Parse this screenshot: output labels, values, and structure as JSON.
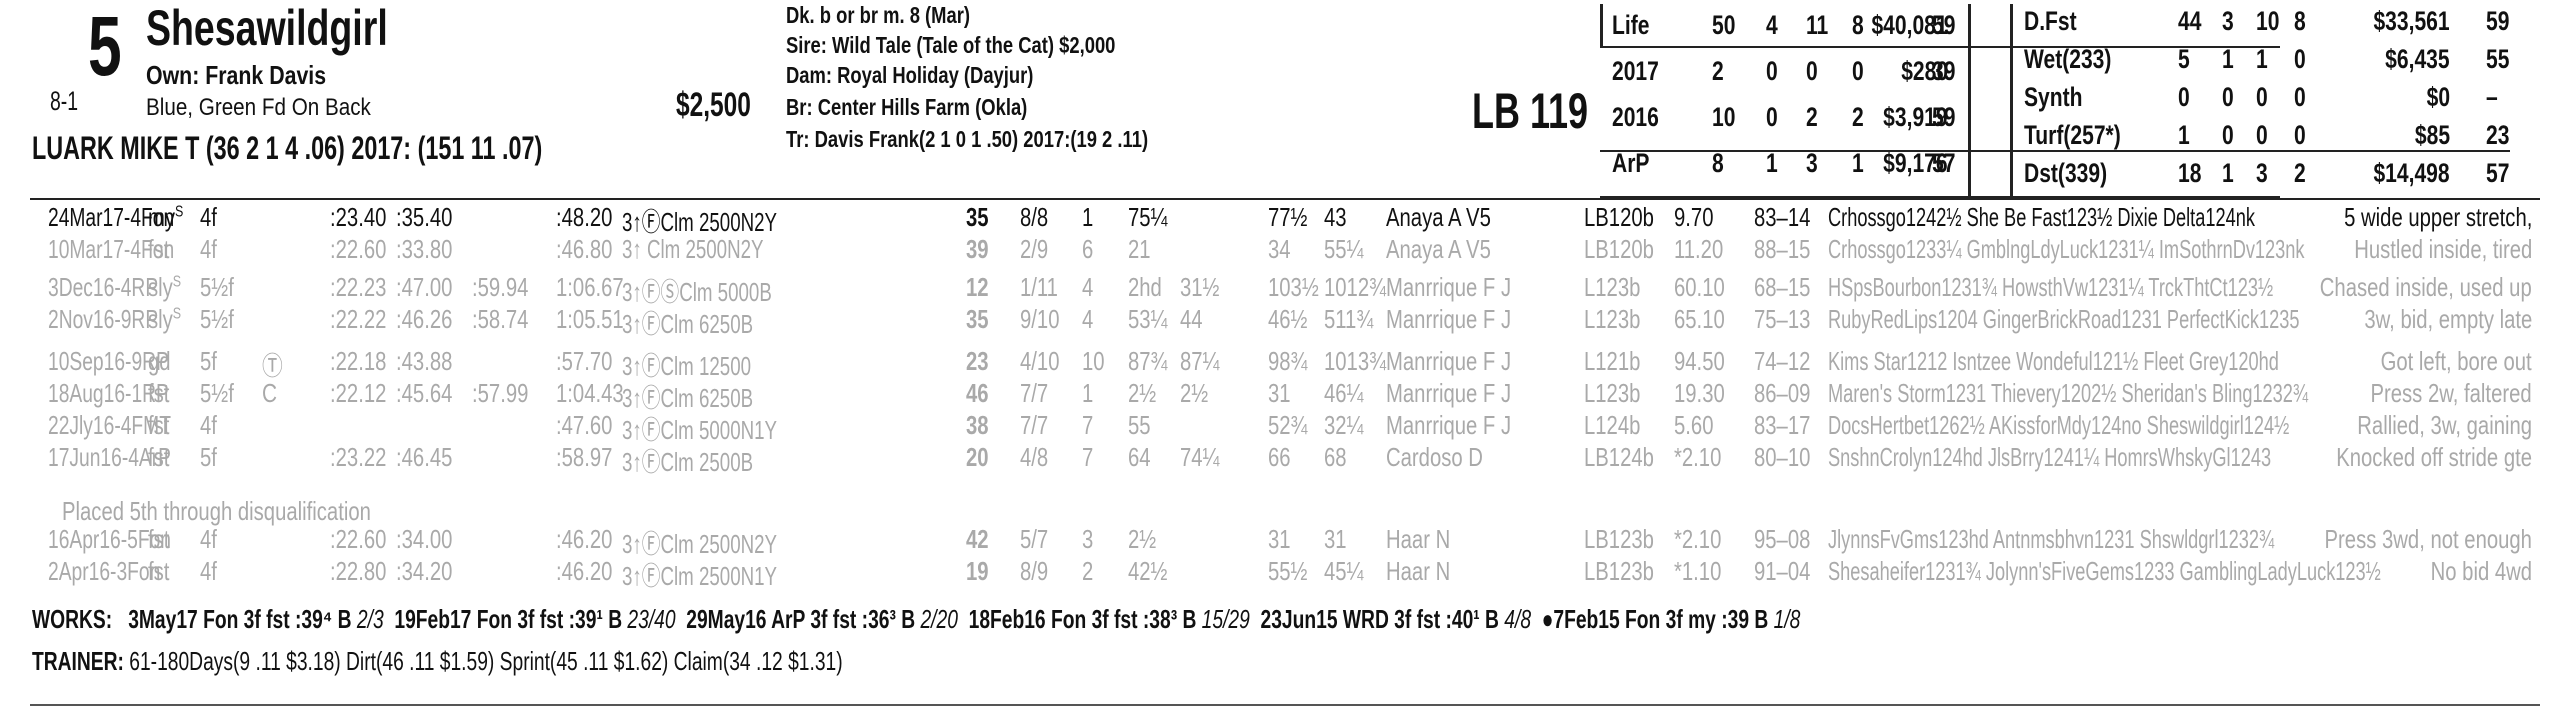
{
  "horse": {
    "program_number": "5",
    "name": "Shesawildgirl",
    "owner": "Own: Frank Davis",
    "odds": "8-1",
    "silks": "Blue, Green Fd On Back",
    "claim_price": "$2,500",
    "jockey": "LUARK MIKE T (36 2 1 4 .06) 2017: (151 11 .07)",
    "description": "Dk. b or br m. 8 (Mar)",
    "sire": "Sire: Wild Tale (Tale of the Cat) $2,000",
    "dam": "Dam: Royal Holiday (Dayjur)",
    "breeder": "Br:   Center Hills Farm (Okla)",
    "trainer": "Tr:    Davis Frank(2 1 0 1 .50) 2017:(19 2 .11)",
    "weight": "LB 119"
  },
  "record_left": [
    [
      "Life",
      "50",
      "4",
      "11",
      "8",
      "$40,081",
      "59"
    ],
    [
      "2017",
      "2",
      "0",
      "0",
      "0",
      "$280",
      "39"
    ],
    [
      "2016",
      "10",
      "0",
      "2",
      "2",
      "$3,919",
      "59"
    ],
    [
      "ArP",
      "8",
      "1",
      "3",
      "1",
      "$9,176",
      "57"
    ]
  ],
  "record_right": [
    [
      "D.Fst",
      "44",
      "3",
      "10",
      "8",
      "$33,561",
      "59"
    ],
    [
      "Wet(233)",
      "5",
      "1",
      "1",
      "0",
      "$6,435",
      "55"
    ],
    [
      "Synth",
      "0",
      "0",
      "0",
      "0",
      "$0",
      "–"
    ],
    [
      "Turf(257*)",
      "1",
      "0",
      "0",
      "0",
      "$85",
      "23"
    ],
    [
      "Dst(339)",
      "18",
      "1",
      "3",
      "2",
      "$14,498",
      "57"
    ]
  ],
  "past_performances": [
    {
      "date": "24Mar17-4Fon",
      "cond": "my",
      "sup": "S",
      "dist": "4f",
      "tc": "",
      "f1": ":23.40",
      "f2": ":35.40",
      "f3": "",
      "f4": ":48.20",
      "race": "3↑ⒻClm 2500N2Y",
      "bris": "35",
      "pp": "8/8",
      "st": "1",
      "c1": "75¼",
      "c2": "",
      "str": "77½",
      "fin": "43",
      "jockey": "Anaya A V5",
      "med": "LB120b",
      "odds": "9.70",
      "sp": "83–14",
      "comment": "Crhossgo1242½ She Be Fast123½ Dixie Delta124nk",
      "trip": "5 wide upper stretch,",
      "dark": true
    },
    {
      "date": "10Mar17-4Fon",
      "cond": "fst",
      "sup": "",
      "dist": "4f",
      "tc": "",
      "f1": ":22.60",
      "f2": ":33.80",
      "f3": "",
      "f4": ":46.80",
      "race": "3↑ Clm 2500N2Y",
      "bris": "39",
      "pp": "2/9",
      "st": "6",
      "c1": "21",
      "c2": "",
      "str": "34",
      "fin": "55¼",
      "jockey": "Anaya A V5",
      "med": "LB120b",
      "odds": "11.20",
      "sp": "88–15",
      "comment": "Crhossgo1233¼ GmblngLdyLuck1231¼ ImSothrnDv123nk",
      "trip": "Hustled inside, tired",
      "dark": false
    },
    {
      "date": "3Dec16-4RP",
      "cond": "sly",
      "sup": "S",
      "dist": "5½f",
      "tc": "",
      "f1": ":22.23",
      "f2": ":47.00",
      "f3": ":59.94",
      "f4": "1:06.67",
      "race": "3↑ⒻⓈClm 5000B",
      "bris": "12",
      "pp": "1/11",
      "st": "4",
      "c1": "2hd",
      "c2": "31½",
      "str": "103½",
      "fin": "1012¾",
      "jockey": "Manrrique F J",
      "med": "L123b",
      "odds": "60.10",
      "sp": "68–15",
      "comment": "HSpsBourbon1231¾ HowsthVw1231¼ TrckThtCt123½",
      "trip": "Chased inside, used up",
      "dark": false
    },
    {
      "date": "2Nov16-9RP",
      "cond": "sly",
      "sup": "S",
      "dist": "5½f",
      "tc": "",
      "f1": ":22.22",
      "f2": ":46.26",
      "f3": ":58.74",
      "f4": "1:05.51",
      "race": "3↑ⒻClm 6250B",
      "bris": "35",
      "pp": "9/10",
      "st": "4",
      "c1": "53¼",
      "c2": "44",
      "str": "46½",
      "fin": "511¾",
      "jockey": "Manrrique F J",
      "med": "L123b",
      "odds": "65.10",
      "sp": "75–13",
      "comment": "RubyRedLips1204 GingerBrickRoad1231 PerfectKick1235",
      "trip": "3w, bid, empty late",
      "dark": false
    },
    {
      "date": "10Sep16-9RP",
      "cond": "gd",
      "sup": "",
      "dist": "5f",
      "tc": "Ⓣ",
      "f1": ":22.18",
      "f2": ":43.88",
      "f3": "",
      "f4": ":57.70",
      "race": "3↑ⒻClm 12500",
      "bris": "23",
      "pp": "4/10",
      "st": "10",
      "c1": "87¾",
      "c2": "87¼",
      "str": "98¾",
      "fin": "1013¾",
      "jockey": "Manrrique F J",
      "med": "L121b",
      "odds": "94.50",
      "sp": "74–12",
      "comment": "Kims Star1212 Isntzee Wondeful121½ Fleet Grey120hd",
      "trip": "Got left, bore out",
      "dark": false
    },
    {
      "date": "18Aug16-1RP",
      "cond": "fst",
      "sup": "",
      "dist": "5½f",
      "tc": "C",
      "f1": ":22.12",
      "f2": ":45.64",
      "f3": ":57.99",
      "f4": "1:04.43",
      "race": "3↑ⒻClm 6250B",
      "bris": "46",
      "pp": "7/7",
      "st": "1",
      "c1": "2½",
      "c2": "2½",
      "str": "31",
      "fin": "46¼",
      "jockey": "Manrrique F J",
      "med": "L123b",
      "odds": "19.30",
      "sp": "86–09",
      "comment": "Maren's Storm1231 Thievery1202½ Sheridan's Bling1232¾",
      "trip": "Press 2w, faltered",
      "dark": false
    },
    {
      "date": "22Jly16-4FMT",
      "cond": "fst",
      "sup": "",
      "dist": "4f",
      "tc": "",
      "f1": "",
      "f2": "",
      "f3": "",
      "f4": ":47.60",
      "race": "3↑ⒻClm 5000N1Y",
      "bris": "38",
      "pp": "7/7",
      "st": "7",
      "c1": "55",
      "c2": "",
      "str": "52¾",
      "fin": "32¼",
      "jockey": "Manrrique F J",
      "med": "L124b",
      "odds": "5.60",
      "sp": "83–17",
      "comment": "DocsHertbet1262½ AKissforMdy124no Sheswildgirl124½",
      "trip": "Rallied, 3w, gaining",
      "dark": false
    },
    {
      "date": "17Jun16-4ArP",
      "cond": "fst",
      "sup": "",
      "dist": "5f",
      "tc": "",
      "f1": ":23.22",
      "f2": ":46.45",
      "f3": "",
      "f4": ":58.97",
      "race": "3↑ⒻClm 2500B",
      "bris": "20",
      "pp": "4/8",
      "st": "7",
      "c1": "64",
      "c2": "74¼",
      "str": "66",
      "fin": "68",
      "jockey": "Cardoso D",
      "med": "LB124b",
      "odds": "*2.10",
      "sp": "80–10",
      "comment": "SnshnCrolyn124hd JlsBrry1241¼ HomrsWhskyGl1243",
      "trip": "Knocked off stride gte",
      "dark": false
    },
    {
      "date": "16Apr16-5Fon",
      "cond": "fst",
      "sup": "",
      "dist": "4f",
      "tc": "",
      "f1": ":22.60",
      "f2": ":34.00",
      "f3": "",
      "f4": ":46.20",
      "race": "3↑ⒻClm 2500N2Y",
      "bris": "42",
      "pp": "5/7",
      "st": "3",
      "c1": "2½",
      "c2": "",
      "str": "31",
      "fin": "31",
      "jockey": "Haar N",
      "med": "LB123b",
      "odds": "*2.10",
      "sp": "95–08",
      "comment": "JlynnsFvGms123hd Antnmsbhvn1231 Shswldgrl1232¾",
      "trip": "Press 3wd, not enough",
      "dark": false
    },
    {
      "date": "2Apr16-3Fon",
      "cond": "fst",
      "sup": "",
      "dist": "4f",
      "tc": "",
      "f1": ":22.80",
      "f2": ":34.20",
      "f3": "",
      "f4": ":46.20",
      "race": "3↑ⒻClm 2500N1Y",
      "bris": "19",
      "pp": "8/9",
      "st": "2",
      "c1": "42½",
      "c2": "",
      "str": "55½",
      "fin": "45¼",
      "jockey": "Haar N",
      "med": "LB123b",
      "odds": "*1.10",
      "sp": "91–04",
      "comment": "Shesaheifer1231¾ Jolynn'sFiveGems1233 GamblingLadyLuck123½",
      "trip": "No bid 4wd",
      "dark": false
    }
  ],
  "dq_note": "Placed 5th through disqualification",
  "works": {
    "label": "WORKS:",
    "items": [
      {
        "text": "3May17 Fon 3f fst :39⁴ B",
        "rank": "2/3"
      },
      {
        "text": "19Feb17 Fon 3f fst :39¹ B",
        "rank": "23/40"
      },
      {
        "text": "29May16 ArP 3f fst :36³ B",
        "rank": "2/20"
      },
      {
        "text": "18Feb16 Fon 3f fst :38³ B",
        "rank": "15/29"
      },
      {
        "text": "23Jun15 WRD 3f fst :40¹ B",
        "rank": "4/8"
      },
      {
        "text": "●7Feb15 Fon 3f my :39 B",
        "rank": "1/8"
      }
    ]
  },
  "trainer_stats": {
    "label": "TRAINER:",
    "text": "61-180Days(9 .11 $3.18) Dirt(46 .11 $1.59) Sprint(45 .11 $1.62) Claim(34 .12 $1.31)"
  }
}
